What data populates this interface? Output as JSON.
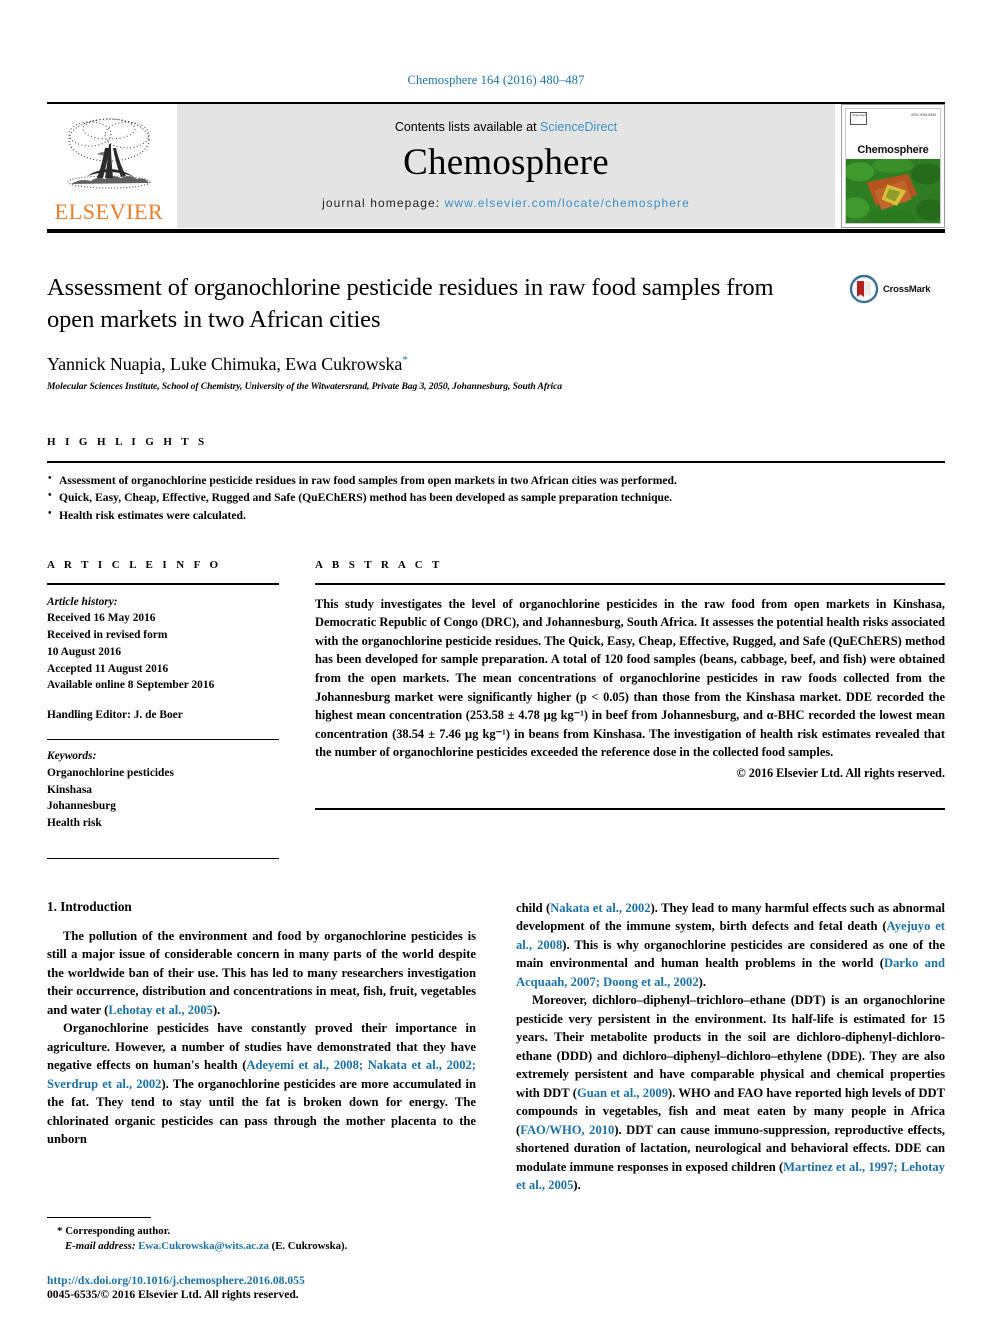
{
  "running_head": "Chemosphere 164 (2016) 480–487",
  "masthead": {
    "publisher": "ELSEVIER",
    "contents_prefix": "Contents lists available at ",
    "contents_link": "ScienceDirect",
    "journal_title": "Chemosphere",
    "homepage_prefix": "journal homepage: ",
    "homepage_url": "www.elsevier.com/locate/chemosphere",
    "cover": {
      "name": "Chemosphere",
      "issn_note": "ISSN 0045-6535",
      "badge_text": "Chemosphere"
    }
  },
  "crossmark": {
    "label": "CrossMark"
  },
  "title": "Assessment of organochlorine pesticide residues in raw food samples from open markets in two African cities",
  "authors": "Yannick Nuapia, Luke Chimuka, Ewa Cukrowska",
  "author_star": "*",
  "affiliation": "Molecular Sciences Institute, School of Chemistry, University of the Witwatersrand, Private Bag 3, 2050, Johannesburg, South Africa",
  "highlights": {
    "label": "H I G H L I G H T S",
    "items": [
      "Assessment of organochlorine pesticide residues in raw food samples from open markets in two African cities was performed.",
      "Quick, Easy, Cheap, Effective, Rugged and Safe (QuEChERS) method has been developed as sample preparation technique.",
      "Health risk estimates were calculated."
    ]
  },
  "article_info": {
    "label": "A R T I C L E  I N F O",
    "history_lead": "Article history:",
    "history_lines": [
      "Received 16 May 2016",
      "Received in revised form",
      "10 August 2016",
      "Accepted 11 August 2016",
      "Available online 8 September 2016"
    ],
    "handling_editor": "Handling Editor: J. de Boer",
    "keywords_lead": "Keywords:",
    "keywords": [
      "Organochlorine pesticides",
      "Kinshasa",
      "Johannesburg",
      "Health risk"
    ]
  },
  "abstract": {
    "label": "A B S T R A C T",
    "text": "This study investigates the level of organochlorine pesticides in the raw food from open markets in Kinshasa, Democratic Republic of Congo (DRC), and Johannesburg, South Africa. It assesses the potential health risks associated with the organochlorine pesticide residues. The Quick, Easy, Cheap, Effective, Rugged, and Safe (QuEChERS) method has been developed for sample preparation. A total of 120 food samples (beans, cabbage, beef, and fish) were obtained from the open markets. The mean concentrations of organochlorine pesticides in raw foods collected from the Johannesburg market were significantly higher (p < 0.05) than those from the Kinshasa market. DDE recorded the highest mean concentration (253.58 ± 4.78 µg kg⁻¹) in beef from Johannesburg, and α-BHC recorded the lowest mean concentration (38.54 ± 7.46 µg kg⁻¹) in beans from Kinshasa. The investigation of health risk estimates revealed that the number of organochlorine pesticides exceeded the reference dose in the collected food samples.",
    "copyright": "© 2016 Elsevier Ltd. All rights reserved."
  },
  "introduction": {
    "heading": "1. Introduction",
    "left_paragraphs": [
      {
        "segments": [
          {
            "t": "The pollution of the environment and food by organochlorine pesticides is still a major issue of considerable concern in many parts of the world despite the worldwide ban of their use. This has led to many researchers investigation their occurrence, distribution and concentrations in meat, fish, fruit, vegetables and water ("
          },
          {
            "t": "Lehotay et al., 2005",
            "cite": true
          },
          {
            "t": ")."
          }
        ]
      },
      {
        "segments": [
          {
            "t": "Organochlorine pesticides have constantly proved their importance in agriculture. However, a number of studies have demonstrated that they have negative effects on human's health ("
          },
          {
            "t": "Adeyemi et al., 2008; Nakata et al., 2002; Sverdrup et al., 2002",
            "cite": true
          },
          {
            "t": "). The organochlorine pesticides are more accumulated in the fat. They tend to stay until the fat is broken down for energy. The chlorinated organic pesticides can pass through the mother placenta to the unborn"
          }
        ]
      }
    ],
    "right_paragraphs": [
      {
        "segments": [
          {
            "t": "child ("
          },
          {
            "t": "Nakata et al., 2002",
            "cite": true
          },
          {
            "t": "). They lead to many harmful effects such as abnormal development of the immune system, birth defects and fetal death ("
          },
          {
            "t": "Ayejuyo et al., 2008",
            "cite": true
          },
          {
            "t": "). This is why organochlorine pesticides are considered as one of the main environmental and human health problems in the world ("
          },
          {
            "t": "Darko and Acquaah, 2007; Doong et al., 2002",
            "cite": true
          },
          {
            "t": ")."
          }
        ]
      },
      {
        "segments": [
          {
            "t": "Moreover, dichloro–diphenyl–trichloro–ethane (DDT) is an organochlorine pesticide very persistent in the environment. Its half-life is estimated for 15 years. Their metabolite products in the soil are dichloro-diphenyl-dichloro-ethane (DDD) and dichloro–diphenyl–dichloro–ethylene (DDE). They are also extremely persistent and have comparable physical and chemical properties with DDT ("
          },
          {
            "t": "Guan et al., 2009",
            "cite": true
          },
          {
            "t": "). WHO and FAO have reported high levels of DDT compounds in vegetables, fish and meat eaten by many people in Africa ("
          },
          {
            "t": "FAO/WHO, 2010",
            "cite": true
          },
          {
            "t": "). DDT can cause immuno-suppression, reproductive effects, shortened duration of lactation, neurological and behavioral effects. DDE can modulate immune responses in exposed children ("
          },
          {
            "t": "Martinez et al., 1997; Lehotay et al., 2005",
            "cite": true
          },
          {
            "t": ")."
          }
        ]
      }
    ]
  },
  "footnotes": {
    "corresponding_star": "*",
    "corresponding_text": "Corresponding author.",
    "email_label": "E-mail address:",
    "email_address": "Ewa.Cukrowska@wits.ac.za",
    "email_suffix": "(E. Cukrowska).",
    "doi": "http://dx.doi.org/10.1016/j.chemosphere.2016.08.055",
    "issn_copyright": "0045-6535/© 2016 Elsevier Ltd. All rights reserved."
  },
  "colors": {
    "link": "#1a72a8",
    "elsevier_orange": "#ec7c26",
    "band_gray": "#e4e4e4"
  }
}
